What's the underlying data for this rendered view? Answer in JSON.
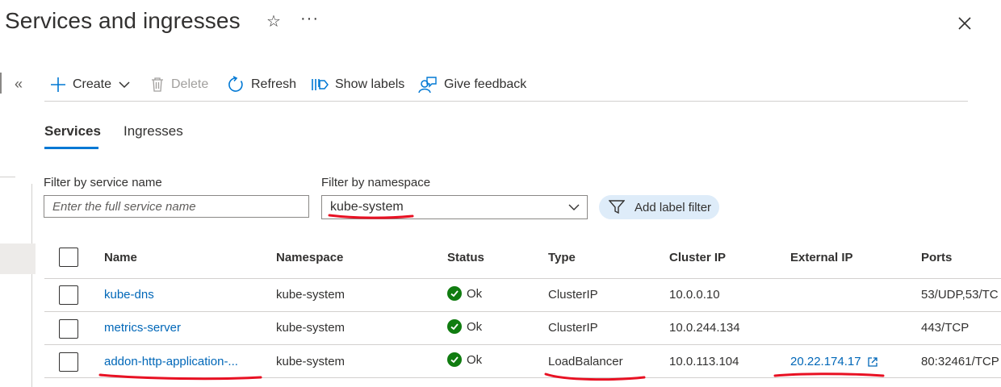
{
  "header": {
    "title": "Services and ingresses",
    "favorite_icon": "star-icon",
    "more_icon": "ellipsis-icon",
    "close_icon": "close-icon",
    "collapse_glyph": "«"
  },
  "toolbar": {
    "create_label": "Create",
    "delete_label": "Delete",
    "refresh_label": "Refresh",
    "show_labels_label": "Show labels",
    "feedback_label": "Give feedback"
  },
  "tabs": [
    {
      "label": "Services",
      "active": true
    },
    {
      "label": "Ingresses",
      "active": false
    }
  ],
  "filters": {
    "service_name_label": "Filter by service name",
    "service_name_placeholder": "Enter the full service name",
    "service_name_value": "",
    "namespace_label": "Filter by namespace",
    "namespace_value": "kube-system",
    "add_label_filter": "Add label filter"
  },
  "table": {
    "columns": [
      "Name",
      "Namespace",
      "Status",
      "Type",
      "Cluster IP",
      "External IP",
      "Ports"
    ],
    "rows": [
      {
        "name": "kube-dns",
        "namespace": "kube-system",
        "status": "Ok",
        "type": "ClusterIP",
        "cluster_ip": "10.0.0.10",
        "external_ip": "",
        "ports": "53/UDP,53/TC"
      },
      {
        "name": "metrics-server",
        "namespace": "kube-system",
        "status": "Ok",
        "type": "ClusterIP",
        "cluster_ip": "10.0.244.134",
        "external_ip": "",
        "ports": "443/TCP"
      },
      {
        "name": "addon-http-application-...",
        "namespace": "kube-system",
        "status": "Ok",
        "type": "LoadBalancer",
        "cluster_ip": "10.0.113.104",
        "external_ip": "20.22.174.17",
        "ports": "80:32461/TCP"
      }
    ]
  },
  "colors": {
    "accent": "#0078d4",
    "link": "#0067b8",
    "ok": "#107c10",
    "annotation": "#e81123",
    "pill_bg": "#deecf9"
  }
}
